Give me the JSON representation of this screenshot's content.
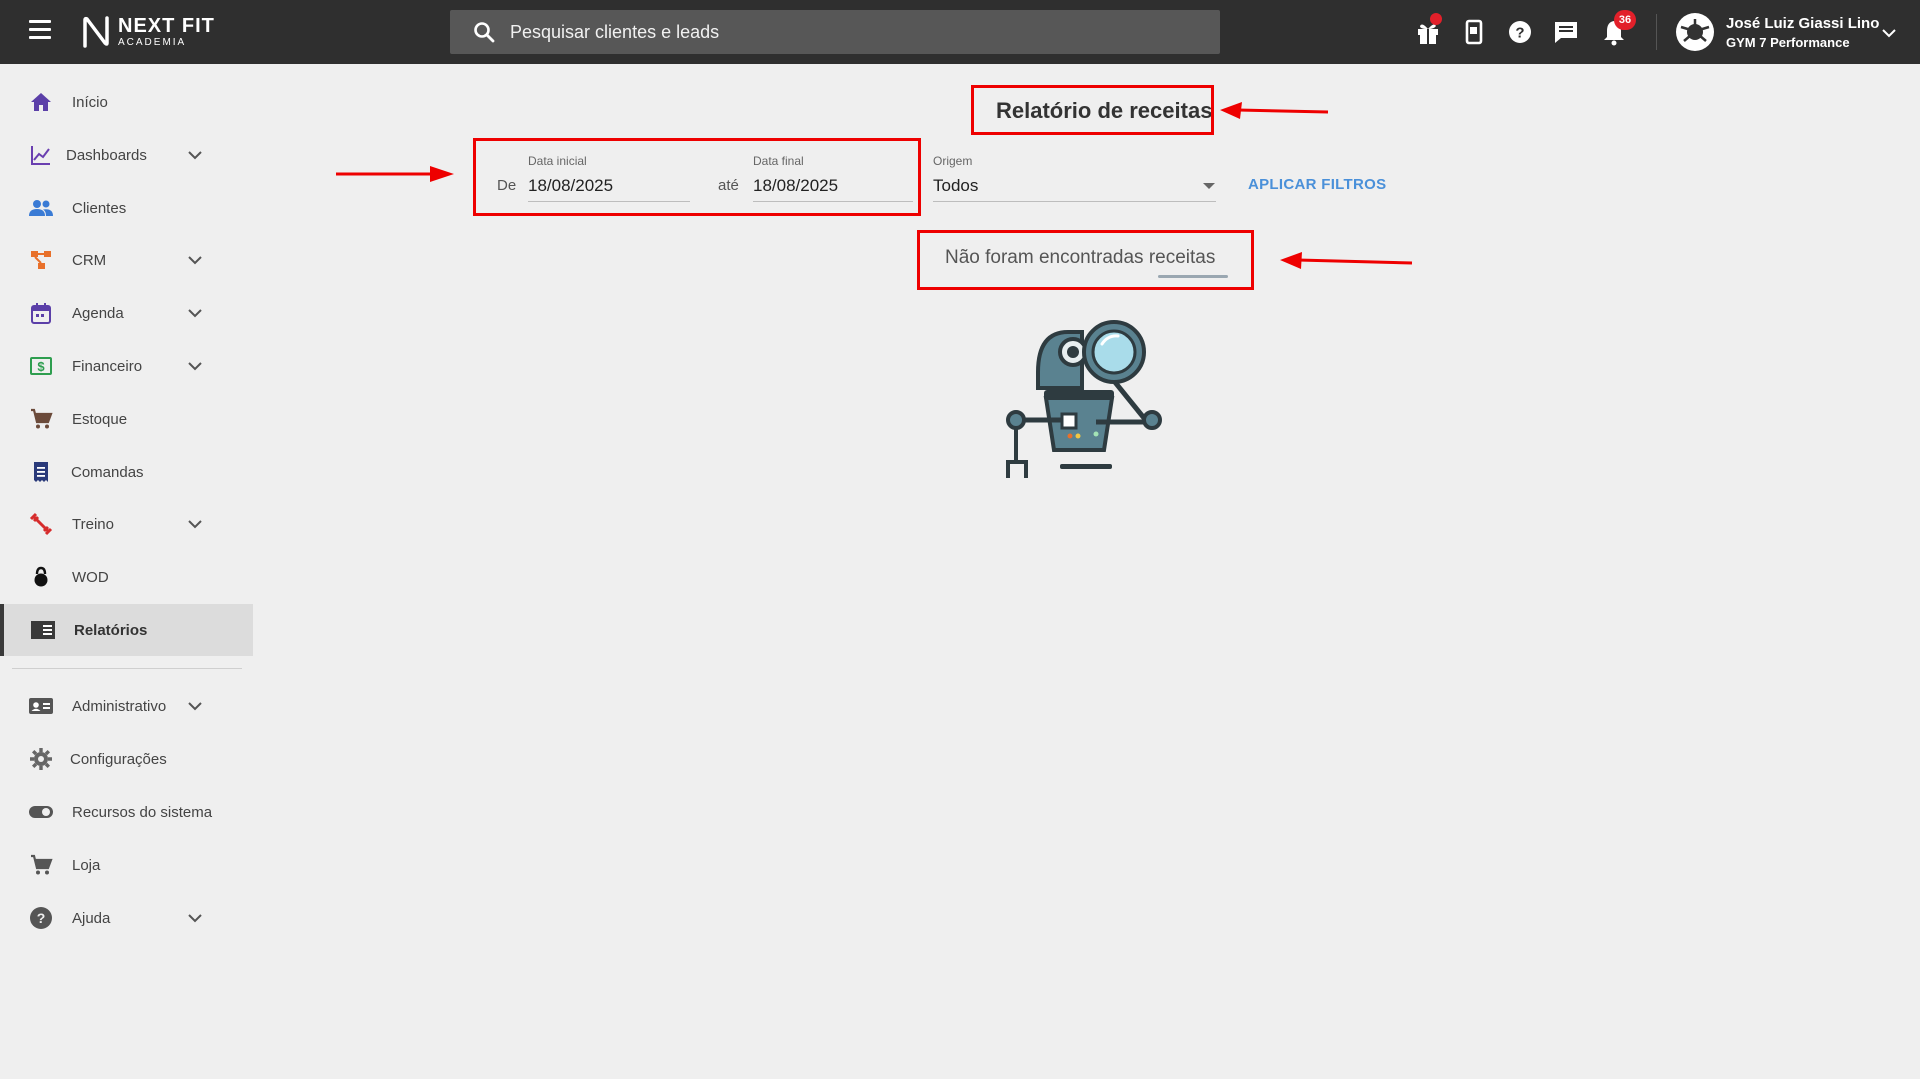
{
  "header": {
    "logo_title": "NEXT FIT",
    "logo_subtitle": "ACADEMIA",
    "search_placeholder": "Pesquisar clientes e leads",
    "notifications_count": "36",
    "user_name": "José Luiz Giassi Lino",
    "user_gym": "GYM 7 Performance"
  },
  "sidebar": {
    "items": [
      {
        "label": "Início",
        "icon": "home-icon",
        "color": "#5b3fa8"
      },
      {
        "label": "Dashboards",
        "icon": "chart-line-icon",
        "color": "#6a3fb0"
      },
      {
        "label": "Clientes",
        "icon": "people-icon",
        "color": "#3a7bd5"
      },
      {
        "label": "CRM",
        "icon": "flow-icon",
        "color": "#e8702a"
      },
      {
        "label": "Agenda",
        "icon": "calendar-icon",
        "color": "#5b3fa8"
      },
      {
        "label": "Financeiro",
        "icon": "money-icon",
        "color": "#2e9e4f"
      },
      {
        "label": "Estoque",
        "icon": "cart-icon",
        "color": "#6b4a3a"
      },
      {
        "label": "Comandas",
        "icon": "receipt-icon",
        "color": "#2a3a7a"
      },
      {
        "label": "Treino",
        "icon": "dumbbell-icon",
        "color": "#d62c2c"
      },
      {
        "label": "WOD",
        "icon": "kettlebell-icon",
        "color": "#111111"
      },
      {
        "label": "Relatórios",
        "icon": "report-icon",
        "color": "#3a3a3a"
      },
      {
        "label": "Administrativo",
        "icon": "id-card-icon",
        "color": "#555555"
      },
      {
        "label": "Configurações",
        "icon": "gear-icon",
        "color": "#666666"
      },
      {
        "label": "Recursos do sistema",
        "icon": "toggle-icon",
        "color": "#555555"
      },
      {
        "label": "Loja",
        "icon": "cart-icon",
        "color": "#555555"
      },
      {
        "label": "Ajuda",
        "icon": "help-icon",
        "color": "#555555"
      }
    ]
  },
  "main": {
    "title": "Relatório de receitas",
    "filters": {
      "de_label": "De",
      "start_label": "Data inicial",
      "start_value": "18/08/2025",
      "ate_label": "até",
      "end_label": "Data final",
      "end_value": "18/08/2025",
      "origin_label": "Origem",
      "origin_value": "Todos",
      "apply_label": "APLICAR FILTROS"
    },
    "empty_message": "Não foram encontradas receitas"
  },
  "colors": {
    "topbar": "#2f2f2f",
    "annotation_red": "#e00000",
    "link_blue": "#4a90d9",
    "badge_red": "#e2202a"
  }
}
